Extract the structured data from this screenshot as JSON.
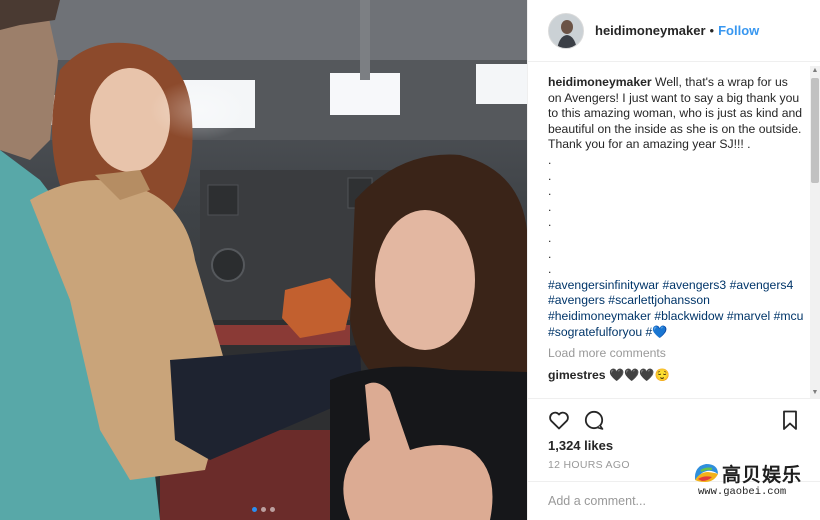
{
  "post": {
    "username": "heidimoneymaker",
    "follow_separator": "•",
    "follow_label": "Follow"
  },
  "caption": {
    "username": "heidimoneymaker",
    "text": "Well, that's a wrap for us on Avengers! I just want to say a big thank you to this amazing woman, who is just as kind and beautiful on the inside as she is on the outside. Thank you for an amazing year SJ!!! .",
    "dots": [
      ".",
      ".",
      ".",
      ".",
      ".",
      ".",
      ".",
      "."
    ],
    "hashtags": "#avengersinfinitywar #avengers3 #avengers4 #avengers #scarlettjohansson #heidimoneymaker #blackwidow #marvel #mcu #sogratefulforyou #💙"
  },
  "comments": {
    "load_more": "Load more comments",
    "partial_username": "gimestres",
    "partial_text": "🖤🖤🖤😌"
  },
  "actions": {
    "likes": "1,324 likes",
    "timestamp": "12 HOURS AGO",
    "add_comment_placeholder": "Add a comment..."
  },
  "carousel": {
    "count": 3,
    "active_index": 0
  },
  "watermark": {
    "title": "高贝娱乐",
    "url": "www.gaobei.com"
  },
  "colors": {
    "follow_blue": "#3897f0",
    "hashtag": "#003569",
    "muted": "#999999",
    "active_dot": "#2b8ef0"
  },
  "icons": {
    "like": "heart-icon",
    "comment": "comment-bubble-icon",
    "save": "bookmark-icon"
  }
}
